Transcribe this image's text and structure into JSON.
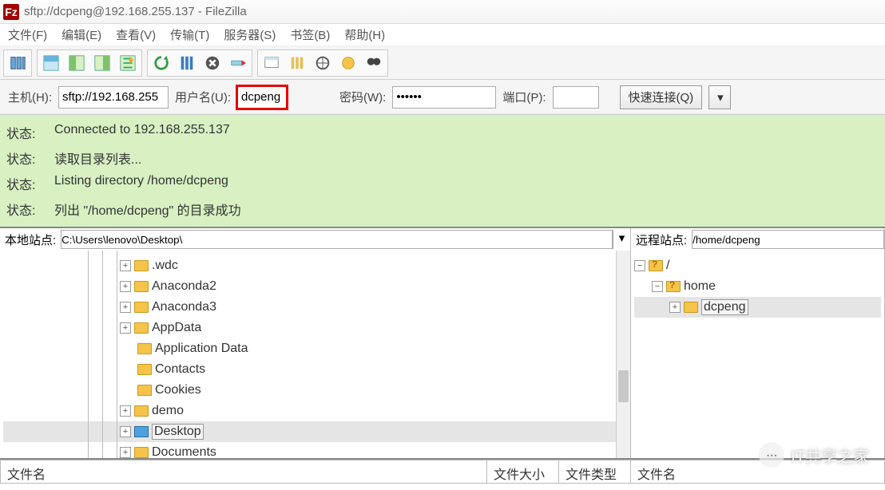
{
  "window": {
    "title": "sftp://dcpeng@192.168.255.137 - FileZilla"
  },
  "menu": {
    "file": "文件(F)",
    "edit": "编辑(E)",
    "view": "查看(V)",
    "transfer": "传输(T)",
    "server": "服务器(S)",
    "bookmarks": "书签(B)",
    "help": "帮助(H)"
  },
  "quickconnect": {
    "host_label": "主机(H):",
    "host_value": "sftp://192.168.255",
    "user_label": "用户名(U):",
    "user_value": "dcpeng",
    "pass_label": "密码(W):",
    "pass_value": "••••••",
    "port_label": "端口(P):",
    "port_value": "",
    "connect_btn": "快速连接(Q)"
  },
  "log": {
    "label": "状态:",
    "lines": [
      "Connected to 192.168.255.137",
      "读取目录列表...",
      "Listing directory /home/dcpeng",
      "列出 \"/home/dcpeng\" 的目录成功"
    ]
  },
  "local": {
    "site_label": "本地站点:",
    "site_value": "C:\\Users\\lenovo\\Desktop\\",
    "tree": [
      {
        "name": ".wdc",
        "exp": "+",
        "icon": "folder"
      },
      {
        "name": "Anaconda2",
        "exp": "+",
        "icon": "folder"
      },
      {
        "name": "Anaconda3",
        "exp": "+",
        "icon": "folder"
      },
      {
        "name": "AppData",
        "exp": "+",
        "icon": "folder"
      },
      {
        "name": "Application Data",
        "exp": "",
        "icon": "folder"
      },
      {
        "name": "Contacts",
        "exp": "",
        "icon": "folder"
      },
      {
        "name": "Cookies",
        "exp": "",
        "icon": "folder"
      },
      {
        "name": "demo",
        "exp": "+",
        "icon": "folder"
      },
      {
        "name": "Desktop",
        "exp": "+",
        "icon": "desktop",
        "selected": true
      },
      {
        "name": "Documents",
        "exp": "+",
        "icon": "folder"
      }
    ]
  },
  "remote": {
    "site_label": "远程站点:",
    "site_value": "/home/dcpeng",
    "root": "/",
    "home": "home",
    "user": "dcpeng"
  },
  "filelist": {
    "col_name": "文件名",
    "col_size": "文件大小",
    "col_type": "文件类型"
  },
  "watermark": "IT共享之家"
}
